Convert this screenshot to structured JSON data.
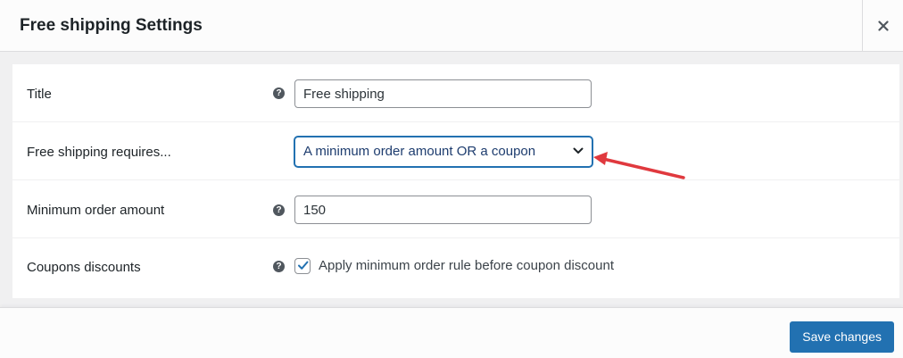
{
  "modal": {
    "title": "Free shipping Settings",
    "close_icon": "close-icon"
  },
  "fields": {
    "title": {
      "label": "Title",
      "value": "Free shipping",
      "help_icon": "help-icon"
    },
    "requires": {
      "label": "Free shipping requires...",
      "selected": "A minimum order amount OR a coupon",
      "icon": "chevron-down-icon"
    },
    "min_amount": {
      "label": "Minimum order amount",
      "value": "150",
      "help_icon": "help-icon"
    },
    "coupons": {
      "label": "Coupons discounts",
      "checkbox_label": "Apply minimum order rule before coupon discount",
      "checked": true,
      "help_icon": "help-icon"
    }
  },
  "annotation": {
    "arrow_color": "#e0393e",
    "points_to": "requires-select"
  },
  "footer": {
    "save_label": "Save changes"
  },
  "colors": {
    "primary": "#2271b1",
    "text": "#1d2327",
    "help_icon": "#50575e",
    "background": "#f0f0f1"
  }
}
